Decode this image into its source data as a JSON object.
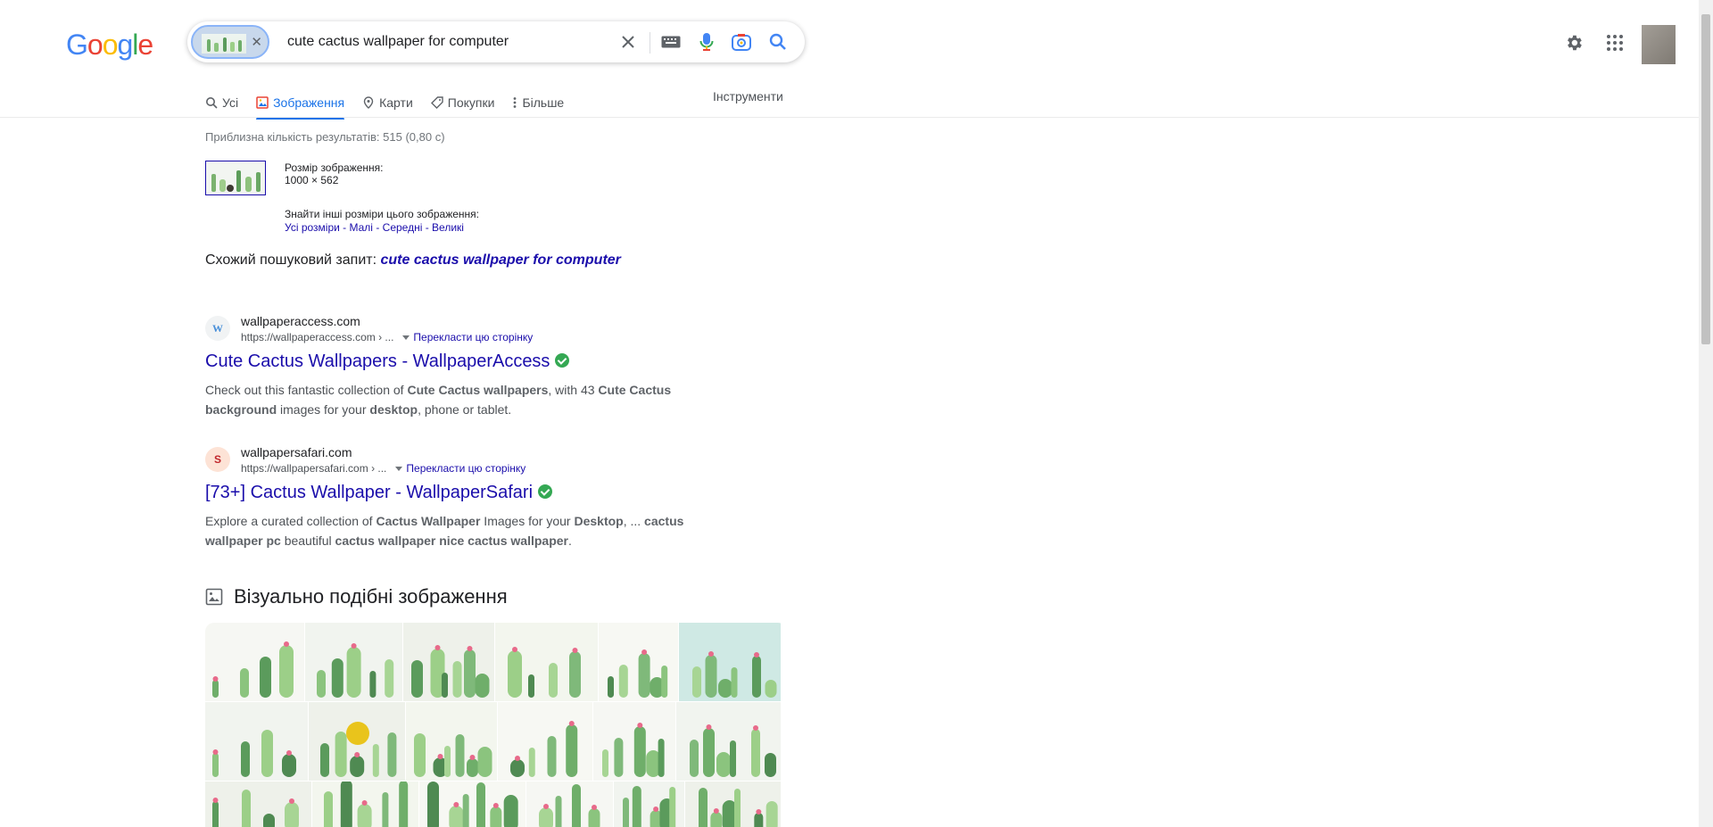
{
  "logo": {
    "letters": [
      "G",
      "o",
      "o",
      "g",
      "l",
      "e"
    ]
  },
  "search": {
    "query": "cute cactus wallpaper for computer"
  },
  "tabs": [
    {
      "label": "Усі",
      "active": false
    },
    {
      "label": "Зображення",
      "active": true
    },
    {
      "label": "Карти",
      "active": false
    },
    {
      "label": "Покупки",
      "active": false
    },
    {
      "label": "Більше",
      "active": false
    }
  ],
  "tools_label": "Інструменти",
  "stats": "Приблизна кількість результатів: 515 (0,80 с)",
  "image_info": {
    "size_label": "Розмір зображення:",
    "size_value": "1000 × 562",
    "find_other": "Знайти інші розміри цього зображення:",
    "links": [
      "Усі розміри",
      "Малі",
      "Середні",
      "Великі"
    ]
  },
  "related": {
    "label": "Схожий пошуковий запит:",
    "query": "cute cactus wallpaper for computer"
  },
  "results": [
    {
      "favicon": "W",
      "site": "wallpaperaccess.com",
      "url": "https://wallpaperaccess.com › ...",
      "translate": "Перекласти цю сторінку",
      "title": "Cute Cactus Wallpapers - WallpaperAccess",
      "snippet_parts": [
        {
          "t": "Check out this fantastic collection of ",
          "b": false
        },
        {
          "t": "Cute Cactus wallpapers",
          "b": true
        },
        {
          "t": ", with 43 ",
          "b": false
        },
        {
          "t": "Cute Cactus background",
          "b": true
        },
        {
          "t": " images for your ",
          "b": false
        },
        {
          "t": "desktop",
          "b": true
        },
        {
          "t": ", phone or tablet.",
          "b": false
        }
      ]
    },
    {
      "favicon": "S",
      "site": "wallpapersafari.com",
      "url": "https://wallpapersafari.com › ...",
      "translate": "Перекласти цю сторінку",
      "title": "[73+] Cactus Wallpaper - WallpaperSafari",
      "snippet_parts": [
        {
          "t": "Explore a curated collection of ",
          "b": false
        },
        {
          "t": "Cactus Wallpaper",
          "b": true
        },
        {
          "t": " Images for your ",
          "b": false
        },
        {
          "t": "Desktop",
          "b": true
        },
        {
          "t": ", ... ",
          "b": false
        },
        {
          "t": "cactus wallpaper pc",
          "b": true
        },
        {
          "t": " beautiful ",
          "b": false
        },
        {
          "t": "cactus wallpaper nice cactus wallpaper",
          "b": true
        },
        {
          "t": ".",
          "b": false
        }
      ]
    }
  ],
  "visual_heading": "Візуально подібні зображення",
  "colors": {
    "link": "#1a0dab",
    "accent": "#1a73e8",
    "verified": "#34a853"
  }
}
